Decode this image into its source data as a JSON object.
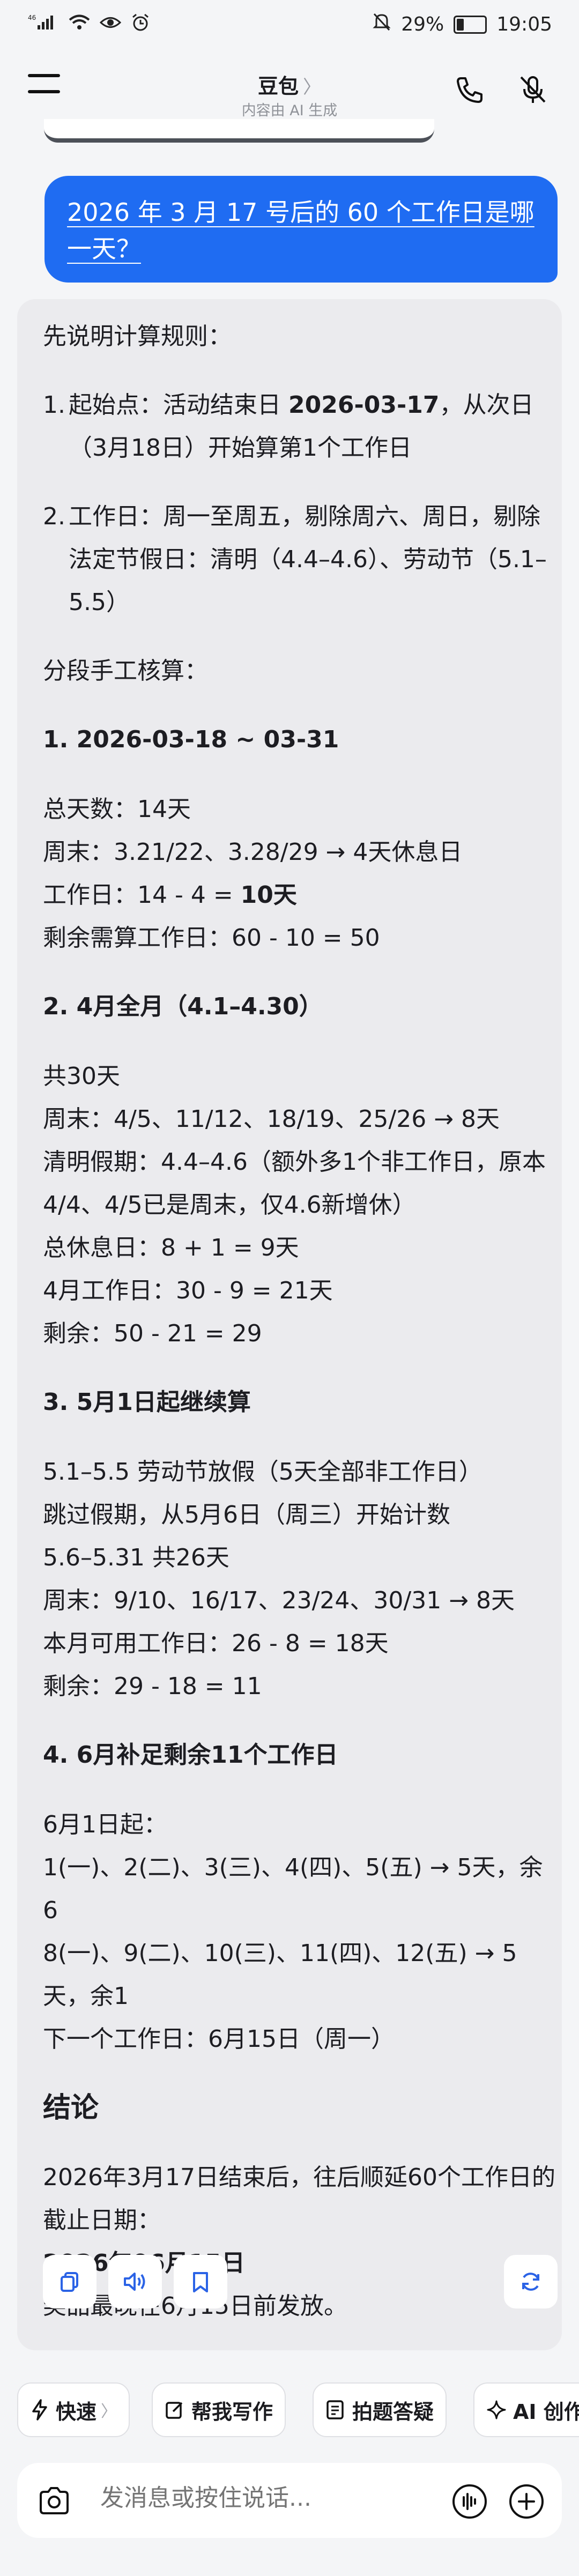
{
  "status_bar": {
    "signal": "⁴⁶ᵢₗₗ",
    "battery": "29%",
    "battery_level": 0.29,
    "time": "19:05"
  },
  "nav": {
    "title": "豆包",
    "title_chevron": "〉",
    "subtitle": "内容由 AI 生成",
    "icons": [
      "menu-icon",
      "phone-icon",
      "mute-icon"
    ]
  },
  "user_message": "2026 年 3 月 17 号后的 60 个工作日是哪一天？",
  "answer": {
    "intro": "先说明计算规则：",
    "rules": [
      {
        "n": "1.",
        "pre": "起始点：活动结束日 ",
        "bold": "2026-03-17",
        "post": "，从次日（3月18日）开始算第1个工作日"
      },
      {
        "n": "2.",
        "pre": "工作日：周一至周五，剔除周六、周日，剔除法定节假日：清明（4.4–4.6）、劳动节（5.1–5.5）",
        "bold": "",
        "post": ""
      }
    ],
    "segment_intro": "分段手工核算：",
    "s1": {
      "title": "1. 2026-03-18 ~ 03-31",
      "l1": "总天数：14天",
      "l2": "周末：3.21/22、3.28/29 → 4天休息日",
      "l3_pre": "工作日：14 - 4 = ",
      "l3_bold": "10天",
      "l4": "剩余需算工作日：60 - 10 = 50"
    },
    "s2": {
      "title": "2. 4月全月（4.1–4.30）",
      "l1": "共30天",
      "l2": "周末：4/5、11/12、18/19、25/26 → 8天",
      "l3": "清明假期：4.4–4.6（额外多1个非工作日，原本4/4、4/5已是周末，仅4.6新增休）",
      "l4": "总休息日：8 + 1 = 9天",
      "l5": "4月工作日：30 - 9 = 21天",
      "l6": "剩余：50 - 21 = 29"
    },
    "s3": {
      "title": "3. 5月1日起继续算",
      "l1": "5.1–5.5 劳动节放假（5天全部非工作日）",
      "l2": "跳过假期，从5月6日（周三）开始计数",
      "l3": "5.6–5.31 共26天",
      "l4": "周末：9/10、16/17、23/24、30/31 → 8天",
      "l5": "本月可用工作日：26 - 8 = 18天",
      "l6": "剩余：29 - 18 = 11"
    },
    "s4": {
      "title": "4. 6月补足剩余11个工作日",
      "l1": "6月1日起：",
      "l2": "1(一)、2(二)、3(三)、4(四)、5(五) → 5天，余6",
      "l3": "8(一)、9(二)、10(三)、11(四)、12(五) → 5天，余1",
      "l4": "下一个工作日：6月15日（周一）"
    },
    "conclusion_title": "结论",
    "conclusion_l1": "2026年3月17日结束后，往后顺延60个工作日的截止日期：",
    "conclusion_date": "2026年06月15日",
    "conclusion_l2": "奖品最晚在6月15日前发放。"
  },
  "answer_actions": [
    "copy-icon",
    "speaker-icon",
    "bookmark-icon",
    "refresh-icon"
  ],
  "chips": [
    {
      "label": "快速",
      "icon": "lightning-icon",
      "chevron": "〉"
    },
    {
      "label": "帮我写作",
      "icon": "edit-icon"
    },
    {
      "label": "拍题答疑",
      "icon": "scan-question-icon"
    },
    {
      "label": "AI 创作",
      "icon": "sparkle-icon"
    }
  ],
  "input": {
    "placeholder": "发消息或按住说话...",
    "icons": [
      "camera-icon",
      "voice-wave-icon",
      "plus-icon"
    ]
  },
  "colors": {
    "accent": "#1f6cf2",
    "background": "#f4f5f7",
    "card": "#ebebee"
  }
}
